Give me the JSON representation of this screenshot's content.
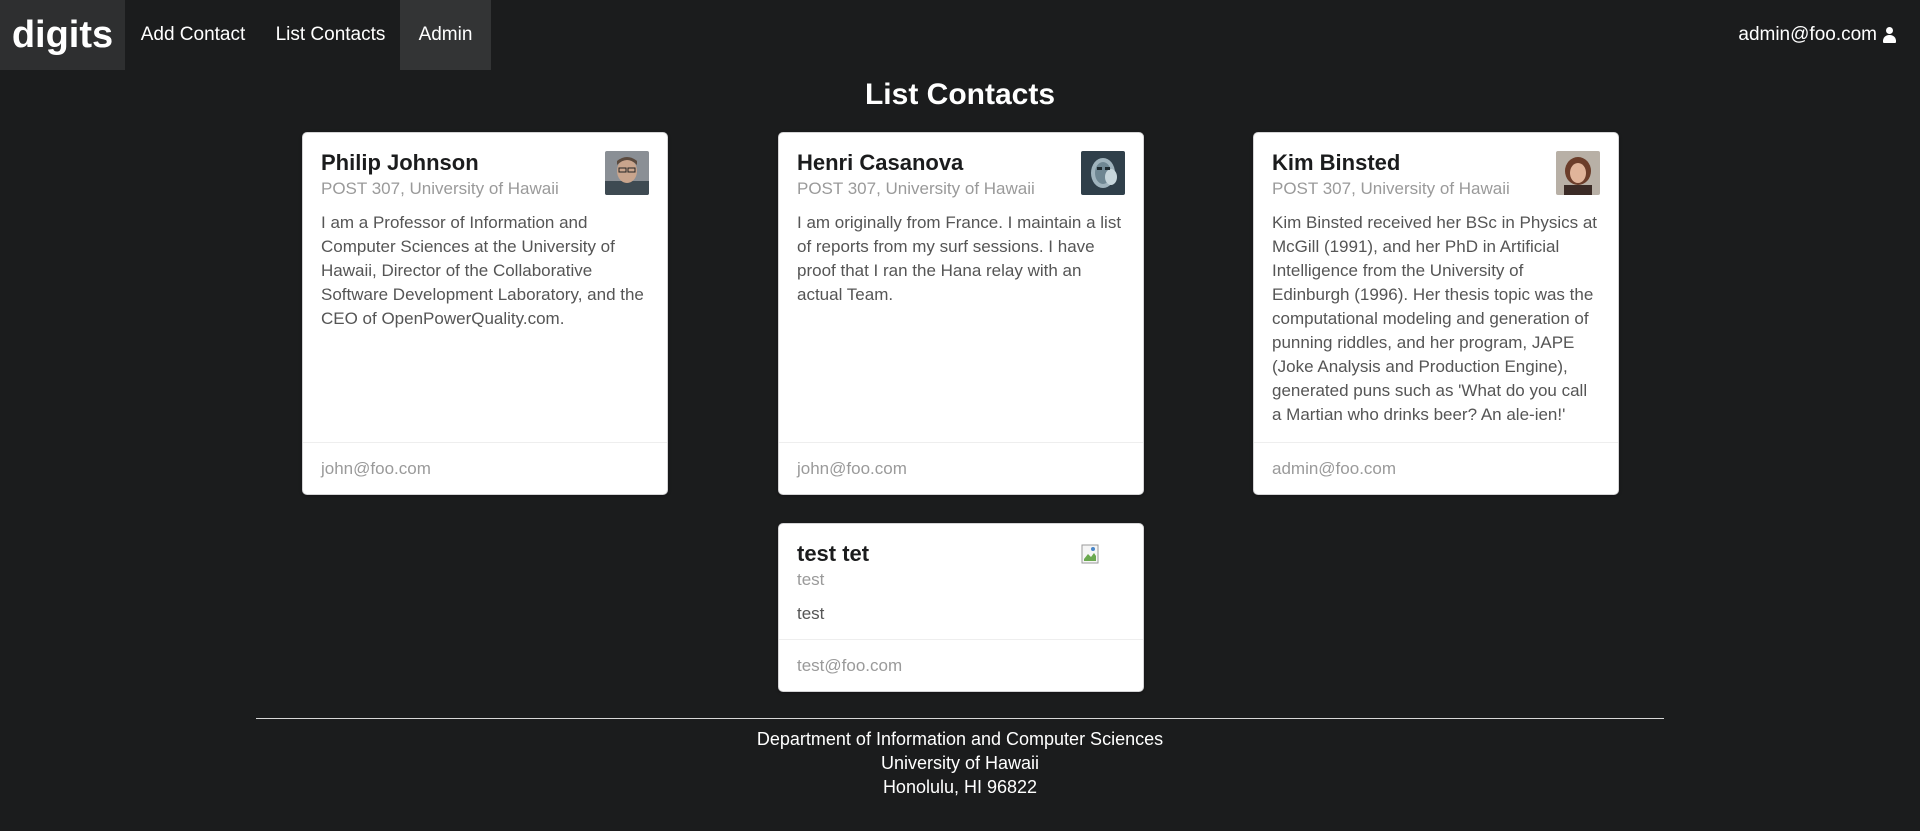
{
  "navbar": {
    "brand": "digits",
    "items": [
      {
        "label": "Add Contact"
      },
      {
        "label": "List Contacts"
      },
      {
        "label": "Admin"
      }
    ],
    "user": "admin@foo.com",
    "user_icon": "user-icon"
  },
  "page": {
    "title": "List Contacts"
  },
  "contacts": [
    {
      "name": "Philip Johnson",
      "address": "POST 307, University of Hawaii",
      "description": "I am a Professor of Information and Computer Sciences at the University of Hawaii, Director of the Collaborative Software Development Laboratory, and the CEO of OpenPowerQuality.com.",
      "owner": "john@foo.com"
    },
    {
      "name": "Henri Casanova",
      "address": "POST 307, University of Hawaii",
      "description": "I am originally from France. I maintain a list of reports from my surf sessions. I have proof that I ran the Hana relay with an actual Team.",
      "owner": "john@foo.com"
    },
    {
      "name": "Kim Binsted",
      "address": "POST 307, University of Hawaii",
      "description": "Kim Binsted received her BSc in Physics at McGill (1991), and her PhD in Artificial Intelligence from the University of Edinburgh (1996). Her thesis topic was the computational modeling and generation of punning riddles, and her program, JAPE (Joke Analysis and Production Engine), generated puns such as 'What do you call a Martian who drinks beer? An ale-ien!'",
      "owner": "admin@foo.com"
    },
    {
      "name": "test tet",
      "address": "test",
      "description": "test",
      "owner": "test@foo.com"
    }
  ],
  "footer": {
    "line1": "Department of Information and Computer Sciences",
    "line2": "University of Hawaii",
    "line3": "Honolulu, HI 96822"
  }
}
